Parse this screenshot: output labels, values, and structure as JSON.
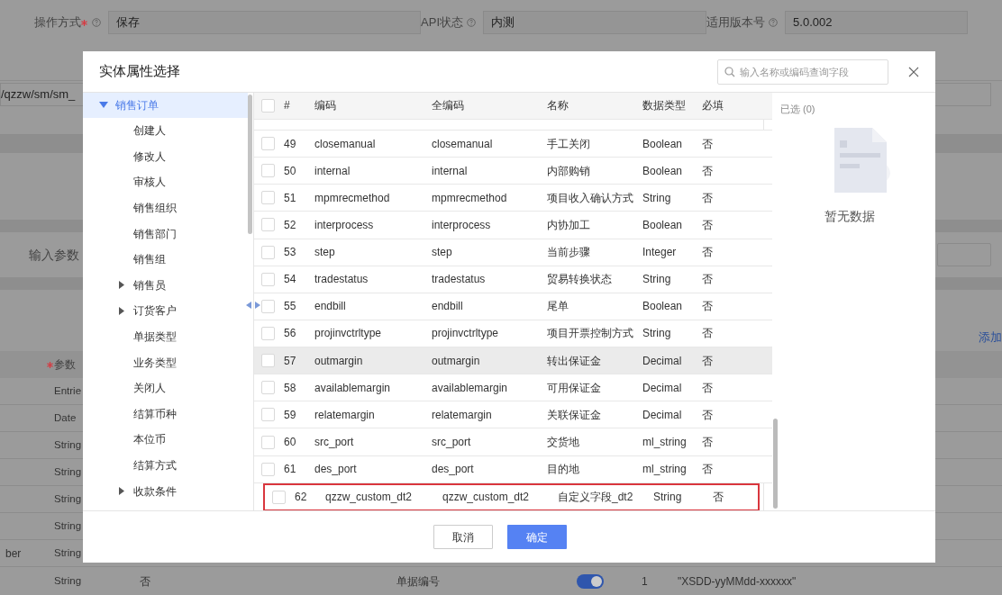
{
  "background": {
    "form_fields": [
      {
        "label": "操作方式",
        "required": true,
        "value": "保存"
      },
      {
        "label": "API状态",
        "required": false,
        "value": "内测"
      },
      {
        "label": "适用版本号",
        "required": false,
        "value": "5.0.002"
      }
    ],
    "path_value": "/qzzw/sm/sm_",
    "param_label": "输入参数",
    "add_link": "添加",
    "param_header": {
      "label": "参数",
      "required": true
    },
    "param_rows": [
      {
        "column_1": "",
        "column_2": "Entrie"
      },
      {
        "column_1": "",
        "column_2": "Date"
      },
      {
        "column_1": "",
        "column_2": "String"
      },
      {
        "column_1": "",
        "column_2": "String"
      },
      {
        "column_1": "",
        "column_2": "String"
      },
      {
        "column_1": "",
        "column_2": "String"
      },
      {
        "column_1": "ber",
        "column_2": "String"
      }
    ],
    "last_row": {
      "column_2": "String",
      "column_3": "否",
      "column_4": "单据编号",
      "toggle_on": true,
      "column_5": "1",
      "column_6": "\"XSDD-yyMMdd-xxxxxx\""
    }
  },
  "dialog": {
    "title": "实体属性选择",
    "search": {
      "placeholder": "输入名称或编码查询字段"
    },
    "tree": {
      "label": "销售订单",
      "expanded": true,
      "selected": true,
      "children": [
        {
          "label": "创建人",
          "has_children": false
        },
        {
          "label": "修改人",
          "has_children": false
        },
        {
          "label": "审核人",
          "has_children": false
        },
        {
          "label": "销售组织",
          "has_children": false
        },
        {
          "label": "销售部门",
          "has_children": false
        },
        {
          "label": "销售组",
          "has_children": false
        },
        {
          "label": "销售员",
          "has_children": true
        },
        {
          "label": "订货客户",
          "has_children": true
        },
        {
          "label": "单据类型",
          "has_children": false
        },
        {
          "label": "业务类型",
          "has_children": false
        },
        {
          "label": "关闭人",
          "has_children": false
        },
        {
          "label": "结算币种",
          "has_children": false
        },
        {
          "label": "本位币",
          "has_children": false
        },
        {
          "label": "结算方式",
          "has_children": false
        },
        {
          "label": "收款条件",
          "has_children": true
        }
      ]
    },
    "table": {
      "all_checked": false,
      "columns": [
        "#",
        "编码",
        "全编码",
        "名称",
        "数据类型",
        "必填"
      ],
      "rows": [
        {
          "cells": [
            "49",
            "closemanual",
            "closemanual",
            "手工关闭",
            "Boolean",
            "否"
          ],
          "checked": false,
          "hovered": false,
          "outlined": false
        },
        {
          "cells": [
            "50",
            "internal",
            "internal",
            "内部购销",
            "Boolean",
            "否"
          ],
          "checked": false,
          "hovered": false,
          "outlined": false
        },
        {
          "cells": [
            "51",
            "mpmrecmethod",
            "mpmrecmethod",
            "项目收入确认方式",
            "String",
            "否"
          ],
          "checked": false,
          "hovered": false,
          "outlined": false
        },
        {
          "cells": [
            "52",
            "interprocess",
            "interprocess",
            "内协加工",
            "Boolean",
            "否"
          ],
          "checked": false,
          "hovered": false,
          "outlined": false
        },
        {
          "cells": [
            "53",
            "step",
            "step",
            "当前步骤",
            "Integer",
            "否"
          ],
          "checked": false,
          "hovered": false,
          "outlined": false
        },
        {
          "cells": [
            "54",
            "tradestatus",
            "tradestatus",
            "贸易转换状态",
            "String",
            "否"
          ],
          "checked": false,
          "hovered": false,
          "outlined": false
        },
        {
          "cells": [
            "55",
            "endbill",
            "endbill",
            "尾单",
            "Boolean",
            "否"
          ],
          "checked": false,
          "hovered": false,
          "outlined": false
        },
        {
          "cells": [
            "56",
            "projinvctrltype",
            "projinvctrltype",
            "项目开票控制方式",
            "String",
            "否"
          ],
          "checked": false,
          "hovered": false,
          "outlined": false
        },
        {
          "cells": [
            "57",
            "outmargin",
            "outmargin",
            "转出保证金",
            "Decimal",
            "否"
          ],
          "checked": false,
          "hovered": true,
          "outlined": false
        },
        {
          "cells": [
            "58",
            "availablemargin",
            "availablemargin",
            "可用保证金",
            "Decimal",
            "否"
          ],
          "checked": false,
          "hovered": false,
          "outlined": false
        },
        {
          "cells": [
            "59",
            "relatemargin",
            "relatemargin",
            "关联保证金",
            "Decimal",
            "否"
          ],
          "checked": false,
          "hovered": false,
          "outlined": false
        },
        {
          "cells": [
            "60",
            "src_port",
            "src_port",
            "交货地",
            "ml_string",
            "否"
          ],
          "checked": false,
          "hovered": false,
          "outlined": false
        },
        {
          "cells": [
            "61",
            "des_port",
            "des_port",
            "目的地",
            "ml_string",
            "否"
          ],
          "checked": false,
          "hovered": false,
          "outlined": false
        },
        {
          "cells": [
            "62",
            "qzzw_custom_dt2",
            "qzzw_custom_dt2",
            "自定义字段_dt2",
            "String",
            "否"
          ],
          "checked": false,
          "hovered": false,
          "outlined": true
        }
      ]
    },
    "selected_panel": {
      "title": "已选 (0)",
      "empty_text": "暂无数据"
    },
    "buttons": [
      {
        "label": "取消",
        "kind": "secondary"
      },
      {
        "label": "确定",
        "kind": "primary"
      }
    ]
  }
}
